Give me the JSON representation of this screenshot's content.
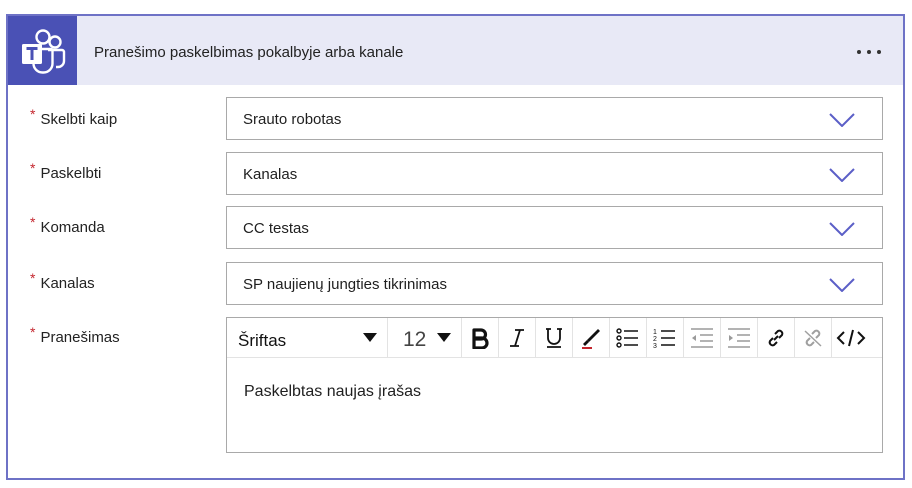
{
  "card": {
    "title": "Pranešimo paskelbimas pokalbyje arba kanale",
    "app_icon": "teams-icon",
    "more_icon": "more-options-icon"
  },
  "fields": [
    {
      "label": "Skelbti kaip",
      "required_mark": "*",
      "value": "Srauto robotas"
    },
    {
      "label": "Paskelbti",
      "required_mark": "*",
      "value": "Kanalas"
    },
    {
      "label": "Komanda",
      "required_mark": "*",
      "value": "CC testas"
    },
    {
      "label": "Kanalas",
      "required_mark": "*",
      "value": "SP naujienų jungties tikrinimas"
    }
  ],
  "message": {
    "label": "Pranešimas",
    "required_mark": "*",
    "font_select": "Šriftas",
    "font_size": "12",
    "body": "Paskelbtas naujas įrašas"
  },
  "colors": {
    "accent": "#4a51b5",
    "border": "#6e72c6",
    "header_bg": "#e8e9f6",
    "required": "#c4262e",
    "chevron": "#5b5fc7"
  }
}
